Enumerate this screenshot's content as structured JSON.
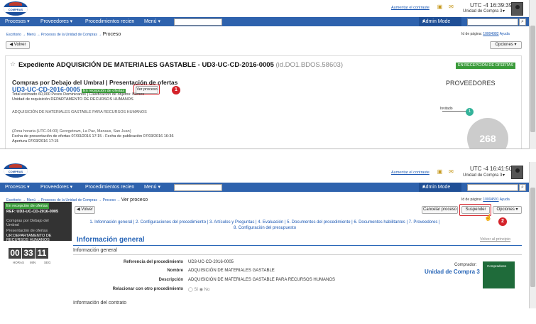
{
  "header": {
    "logo_text": "COMPRAS DOMINICANA",
    "contrast_link": "Aumentar el contraste",
    "utc_a": "UTC -4 16:39:39",
    "utc_b": "UTC -4 16:41:50",
    "unit": "Unidad de Compra 3"
  },
  "nav": {
    "items": [
      "Procesos",
      "Proveedores",
      "Procedimientos recien",
      "Menú"
    ],
    "ira": "Ir a",
    "admin": "Admin Mode",
    "search_placeholder": "Buscar..."
  },
  "top": {
    "crumb": "Escritorio → Menú → Procesos de la Unidad de Compras → ",
    "crumb_current": "Proceso",
    "page_id_label": "Id de página: ",
    "page_id": "10004982",
    "help": "Ayuda",
    "back": "Volver",
    "options": "Opciones",
    "expediente_title": "Expediente  ADQUISICIÓN DE MATERIALES GASTABLE - UD3-UC-CD-2016-0005",
    "expediente_id": "(id.DO1.BDOS.58603)",
    "status_badge": "EN RECEPCIÓN DE OFERTAS",
    "proc_title": "Compras por Debajo del Umbral | Presentación de ofertas",
    "ref": "UD3-UC-CD-2016-0005",
    "ref_badge": "En recepción de ofertas",
    "ver_proceso": "Ver proceso",
    "callout1": "1",
    "total": "Total estimado 60,000 Pesos Dominicanos | Clasificación de objetos: Bienes",
    "unidad_req": "Unidad de requisición DEPARTAMENTO DE RECURSOS HUMANOS",
    "desc": "ADQUISICIÓN DE MATERIALES GASTABLE PARA RECURSOS HUMANOS",
    "zona": "(Zona horaria (UTC-04:00) Georgetown, La Paz, Manaus, San Juan)",
    "fechas": "Fecha de presentación de ofertas 07/03/2016 17:15 - Fecha de publicación 07/03/2016 16:36",
    "apertura": "Apertura 07/03/2016 17:15",
    "proveedores_title": "PROVEEDORES",
    "invitado": "Invitado",
    "invitado_count": "1",
    "total_prov": "268"
  },
  "bottom": {
    "crumb": "Escritorio → Menú → Procesos de la Unidad de Compras → Proceso → ",
    "crumb_current": "Ver proceso",
    "page_id_label": "Id de página: ",
    "page_id": "10004591",
    "help": "Ayuda",
    "back": "Volver",
    "cancel": "Cancelar proceso",
    "suspend": "Suspender",
    "options": "Opciones",
    "callout2": "2",
    "sidebar_badge": "En recepción de ofertas",
    "sidebar_ref": "REF: UD3-UC-CD-2016-0005",
    "sidebar_type": "Compras por Debajo del Umbral",
    "sidebar_phase": "Presentación de ofertas",
    "sidebar_ur": "UR:DEPARTAMENTO DE RECURSOS HUMANOS",
    "timer": [
      "00",
      "33",
      "11"
    ],
    "timer_labels": [
      "HORAS",
      "MIN",
      "SEG"
    ],
    "steps_line1": "1. Información general  |  2. Configuraciones del procedimiento  |  3. Artículos y Preguntas  |  4. Evaluación  |  5. Documentos del procedimiento  |  6. Documentos habilitantes  |  7. Proveedores  |",
    "steps_line2": "8. Configuración del presupuesto",
    "info_title": "Información general",
    "volver_inicio": "Volver al principio",
    "section1": "Información general",
    "ref_label": "Referencia del procedimiento",
    "ref_val": "UD3-UC-CD-2016-0005",
    "name_label": "Nombre",
    "name_val": "ADQUISICIÓN DE MATERIALES GASTABLE",
    "desc_label": "Descripción",
    "desc_val": "ADQUISICIÓN DE MATERIALES GASTABLE PARA RECURSOS HUMANOS",
    "rel_label": "Relacionar con otro procedimiento",
    "rel_si": "Sí",
    "rel_no": "No",
    "comprador_label": "Comprador:",
    "comprador_val": "Unidad de Compra 3",
    "comp_logo_text": "Compradores",
    "section2": "Información del contrato"
  }
}
